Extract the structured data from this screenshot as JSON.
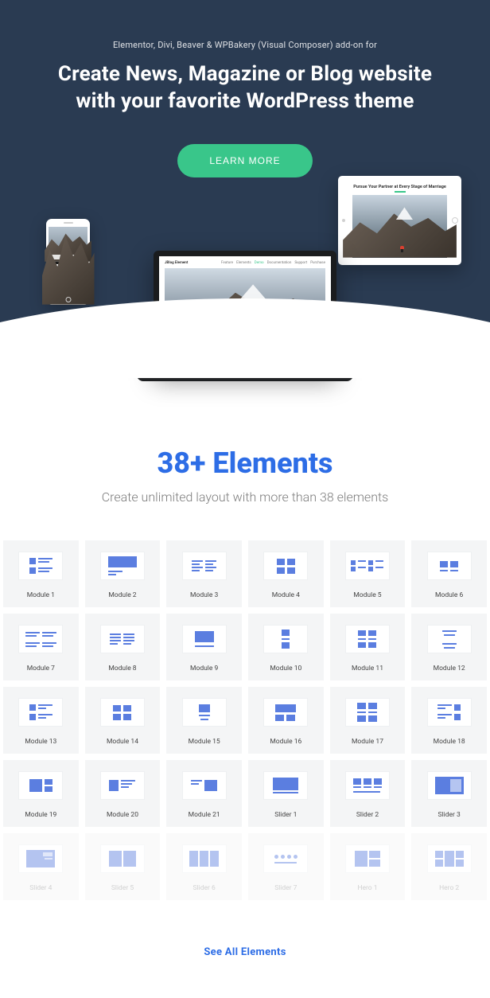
{
  "hero": {
    "subtitle": "Elementor, Divi, Beaver & WPBakery (Visual Composer) add-on for",
    "title": "Create News, Magazine or Blog website with your favorite WordPress theme",
    "cta": "LEARN MORE"
  },
  "laptop": {
    "logo": "JBlog Element",
    "nav": [
      "Feature",
      "Elements",
      "Demo",
      "Documentation",
      "Support",
      "Purchase"
    ],
    "caption": "Pursue Your Partner at Every Stage of Marriage",
    "base": "MacBook"
  },
  "tablet": {
    "caption": "Pursue Your Partner at Every Stage of Marriage"
  },
  "elements": {
    "title": "38+ Elements",
    "subtitle": "Create unlimited layout with more than 38 elements",
    "items": [
      {
        "label": "Module 1",
        "icon": "m1"
      },
      {
        "label": "Module 2",
        "icon": "m2"
      },
      {
        "label": "Module 3",
        "icon": "m3"
      },
      {
        "label": "Module 4",
        "icon": "m4"
      },
      {
        "label": "Module 5",
        "icon": "m5"
      },
      {
        "label": "Module 6",
        "icon": "m6"
      },
      {
        "label": "Module 7",
        "icon": "m7"
      },
      {
        "label": "Module 8",
        "icon": "m8"
      },
      {
        "label": "Module 9",
        "icon": "m9"
      },
      {
        "label": "Module 10",
        "icon": "m10"
      },
      {
        "label": "Module 11",
        "icon": "m11"
      },
      {
        "label": "Module 12",
        "icon": "m12"
      },
      {
        "label": "Module 13",
        "icon": "m13"
      },
      {
        "label": "Module 14",
        "icon": "m14"
      },
      {
        "label": "Module 15",
        "icon": "m15"
      },
      {
        "label": "Module 16",
        "icon": "m16"
      },
      {
        "label": "Module 17",
        "icon": "m17"
      },
      {
        "label": "Module 18",
        "icon": "m18"
      },
      {
        "label": "Module 19",
        "icon": "m19"
      },
      {
        "label": "Module 20",
        "icon": "m20"
      },
      {
        "label": "Module 21",
        "icon": "m21"
      },
      {
        "label": "Slider 1",
        "icon": "s1"
      },
      {
        "label": "Slider 2",
        "icon": "s2"
      },
      {
        "label": "Slider 3",
        "icon": "s3"
      },
      {
        "label": "Slider 4",
        "icon": "s4",
        "faded": true
      },
      {
        "label": "Slider 5",
        "icon": "s5",
        "faded": true
      },
      {
        "label": "Slider 6",
        "icon": "s6",
        "faded": true
      },
      {
        "label": "Slider 7",
        "icon": "s7",
        "faded": true
      },
      {
        "label": "Hero 1",
        "icon": "h1",
        "faded": true
      },
      {
        "label": "Hero 2",
        "icon": "h2",
        "faded": true
      }
    ],
    "see_all": "See All Elements"
  }
}
